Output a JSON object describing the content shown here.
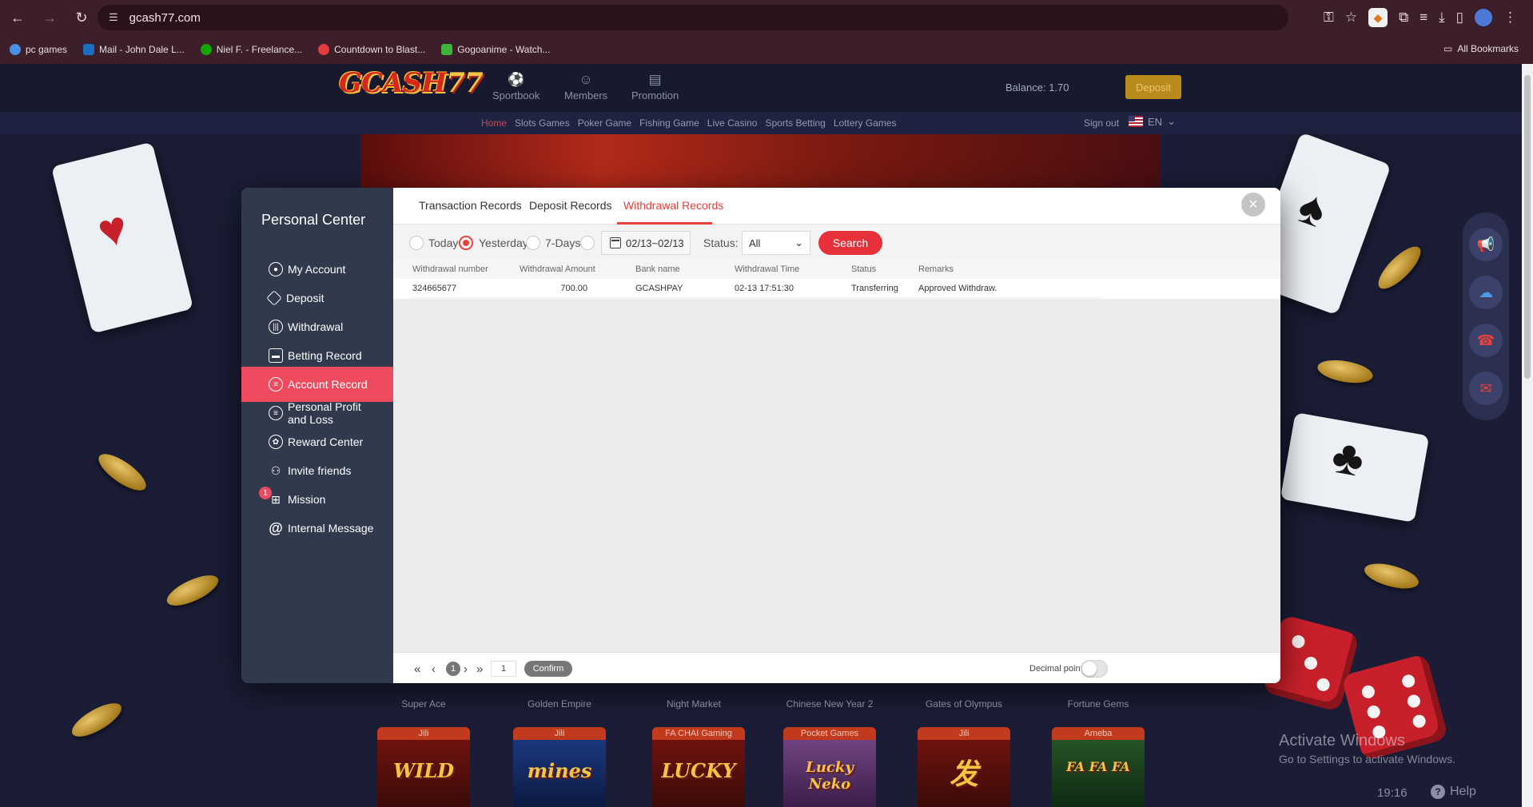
{
  "browser": {
    "url": "gcash77.com",
    "bookmarks": [
      "pc games",
      "Mail - John Dale L...",
      "Niel F. - Freelance...",
      "Countdown to Blast...",
      "Gogoanime - Watch..."
    ],
    "all_bookmarks": "All Bookmarks"
  },
  "site": {
    "logo_text": "GCASH",
    "logo_number": "77",
    "nav": [
      "Sportbook",
      "Members",
      "Promotion"
    ],
    "balance": "Balance: 1.70",
    "deposit_button": "Deposit",
    "subnav": [
      "Home",
      "Slots Games",
      "Poker Game",
      "Fishing Game",
      "Live Casino",
      "Sports Betting",
      "Lottery Games"
    ],
    "sign_out": "Sign out",
    "language": "EN"
  },
  "games": {
    "labels": [
      "Super Ace",
      "Golden Empire",
      "Night Market",
      "Chinese New Year 2",
      "Gates of Olympus",
      "Fortune Gems"
    ],
    "tiles": [
      {
        "tag": "Jili",
        "art": "WILD"
      },
      {
        "tag": "Jili",
        "art": "mines"
      },
      {
        "tag": "FA CHAI Gaming",
        "art": "LUCKY"
      },
      {
        "tag": "Pocket Games",
        "art": "Lucky Neko"
      },
      {
        "tag": "Jili",
        "art": "发"
      },
      {
        "tag": "Ameba",
        "art": "FA FA FA"
      }
    ]
  },
  "modal": {
    "sidebar_title": "Personal Center",
    "menu": [
      {
        "label": "My Account",
        "icon": "user-circle-icon"
      },
      {
        "label": "Deposit",
        "icon": "diamond-icon"
      },
      {
        "label": "Withdrawal",
        "icon": "withdrawal-icon"
      },
      {
        "label": "Betting Record",
        "icon": "wallet-icon"
      },
      {
        "label": "Account Record",
        "icon": "list-icon"
      },
      {
        "label": "Personal Profit and Loss",
        "icon": "chart-icon"
      },
      {
        "label": "Reward Center",
        "icon": "gift-circle-icon"
      },
      {
        "label": "Invite friends",
        "icon": "users-icon"
      },
      {
        "label": "Mission",
        "icon": "gift-icon"
      },
      {
        "label": "Internal Message",
        "icon": "at-icon"
      }
    ],
    "mission_badge": "1",
    "tabs": [
      "Transaction Records",
      "Deposit Records",
      "Withdrawal Records"
    ],
    "active_tab": "Withdrawal Records",
    "filters": {
      "options": [
        "Today",
        "Yesterday",
        "7-Days"
      ],
      "selected": "Yesterday",
      "date_range": "02/13~02/13",
      "status_label": "Status:",
      "status_value": "All",
      "search_button": "Search"
    },
    "table": {
      "headers": [
        "Withdrawal number",
        "Withdrawal Amount",
        "Bank name",
        "Withdrawal Time",
        "Status",
        "Remarks"
      ],
      "rows": [
        [
          "324665677",
          "700.00",
          "GCASHPAY",
          "02-13 17:51:30",
          "Transferring",
          "Approved Withdraw."
        ]
      ]
    },
    "pager": {
      "current_page": "1",
      "page_input": "1",
      "confirm": "Confirm",
      "decimal_label": "Decimal point",
      "decimal_on": false
    }
  },
  "os": {
    "activate_title": "Activate Windows",
    "activate_sub": "Go to Settings to activate Windows.",
    "time": "19:16",
    "help": "Help"
  },
  "colors": {
    "accent_red": "#e8403a",
    "sidebar_bg": "#303a4c",
    "active_menu": "#ee4b5f",
    "browser_bar": "#3c1f2a"
  }
}
